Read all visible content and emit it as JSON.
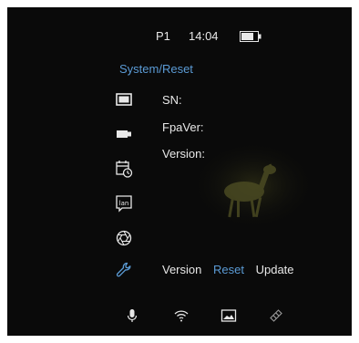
{
  "status_bar": {
    "profile": "P1",
    "time": "14:04",
    "battery_icon": "battery-icon"
  },
  "menu": {
    "title": "System/Reset",
    "side_icons": [
      "display-icon",
      "camera-icon",
      "calendar-clock-icon",
      "language-icon",
      "aperture-icon",
      "wrench-icon"
    ]
  },
  "info": {
    "sn_label": "SN:",
    "fpa_label": "FpaVer:",
    "version_label": "Version:"
  },
  "tabs": [
    {
      "label": "Version"
    },
    {
      "label": "Reset",
      "active": true
    },
    {
      "label": "Update"
    }
  ],
  "bottom_bar": {
    "icons": [
      "microphone-icon",
      "wifi-icon",
      "image-icon",
      "satellite-icon"
    ]
  },
  "colors": {
    "accent": "#5b9bd5",
    "background": "#0a0a0a",
    "text": "#e8e8e8"
  }
}
